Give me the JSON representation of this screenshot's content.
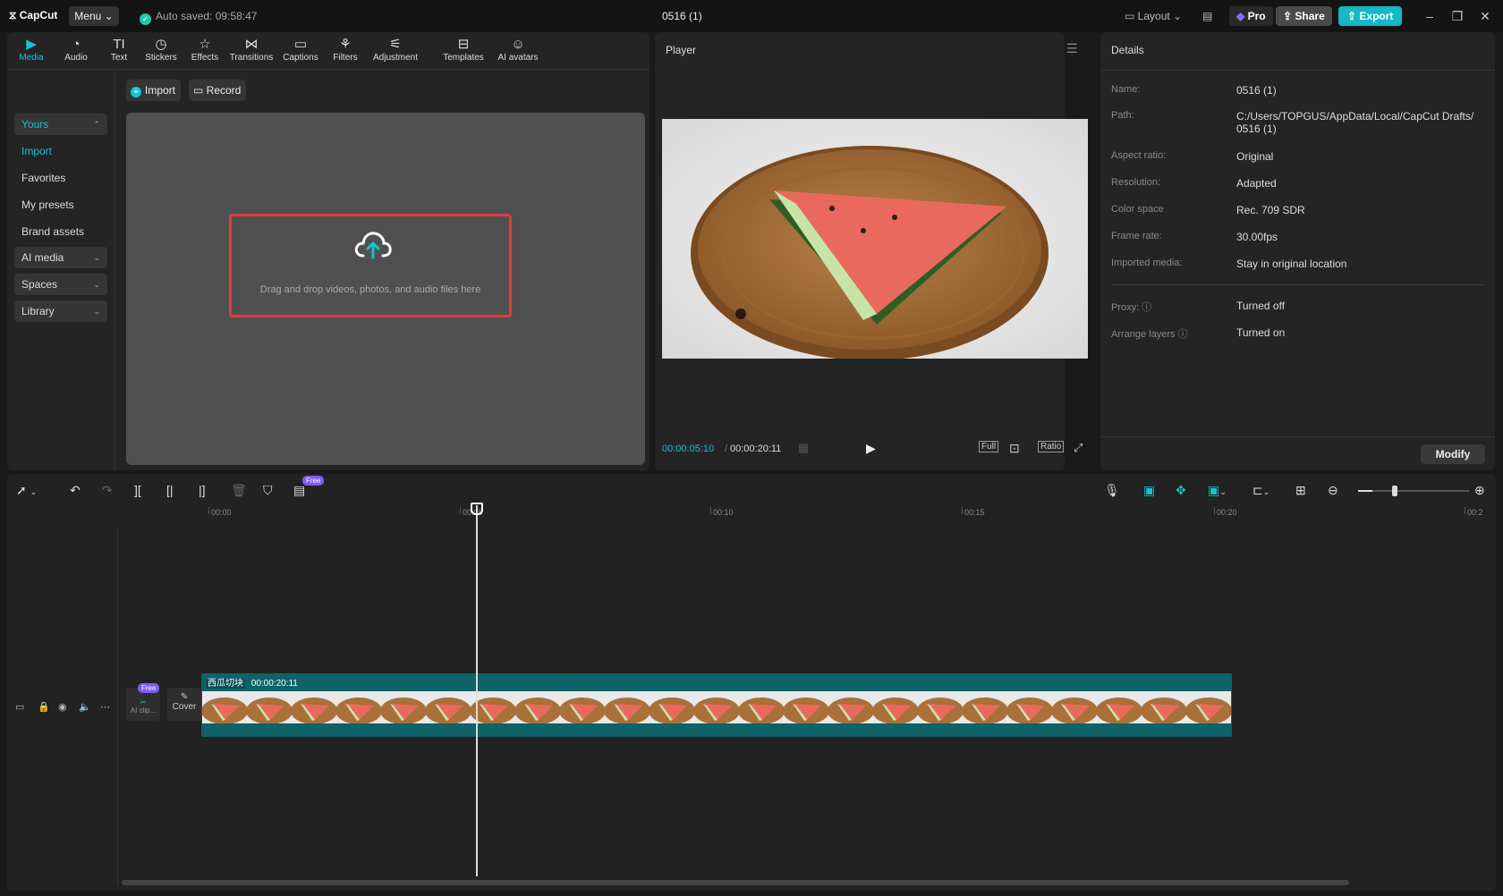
{
  "titlebar": {
    "logo": "CapCut",
    "menu": "Menu",
    "autosave": "Auto saved: 09:58:47",
    "project": "0516 (1)",
    "layout": "Layout",
    "pro": "Pro",
    "share": "Share",
    "export": "Export"
  },
  "tooltabs": [
    {
      "label": "Media",
      "icon": "media-icon"
    },
    {
      "label": "Audio",
      "icon": "audio-icon"
    },
    {
      "label": "Text",
      "icon": "text-icon"
    },
    {
      "label": "Stickers",
      "icon": "stickers-icon"
    },
    {
      "label": "Effects",
      "icon": "effects-icon"
    },
    {
      "label": "Transitions",
      "icon": "transitions-icon"
    },
    {
      "label": "Captions",
      "icon": "captions-icon"
    },
    {
      "label": "Filters",
      "icon": "filters-icon"
    },
    {
      "label": "Adjustment",
      "icon": "adjustment-icon"
    },
    {
      "label": "Templates",
      "icon": "templates-icon"
    },
    {
      "label": "AI avatars",
      "icon": "ai-avatars-icon"
    }
  ],
  "sidenav": {
    "yours": "Yours",
    "import": "Import",
    "favorites": "Favorites",
    "presets": "My presets",
    "brand": "Brand assets",
    "aimedia": "AI media",
    "spaces": "Spaces",
    "library": "Library"
  },
  "media": {
    "import_btn": "Import",
    "record_btn": "Record",
    "drop_text": "Drag and drop videos, photos, and audio files here"
  },
  "player": {
    "title": "Player",
    "current_time": "00:00:05:10",
    "total_time": "00:00:20:11",
    "full": "Full",
    "ratio": "Ratio"
  },
  "details": {
    "title": "Details",
    "rows": [
      {
        "label": "Name:",
        "value": "0516 (1)"
      },
      {
        "label": "Path:",
        "value": "C:/Users/TOPGUS/AppData/Local/CapCut Drafts/ 0516 (1)"
      },
      {
        "label": "Aspect ratio:",
        "value": "Original"
      },
      {
        "label": "Resolution:",
        "value": "Adapted"
      },
      {
        "label": "Color space",
        "value": "Rec. 709 SDR"
      },
      {
        "label": "Frame rate:",
        "value": "30.00fps"
      },
      {
        "label": "Imported media:",
        "value": "Stay in original location"
      },
      {
        "label": "Proxy:",
        "value": "Turned off"
      },
      {
        "label": "Arrange layers",
        "value": "Turned on"
      }
    ],
    "modify": "Modify"
  },
  "timeline": {
    "free_badge": "Free",
    "ticks": [
      "00:00",
      "00:05",
      "00:10",
      "00:15",
      "00:20",
      "00:2"
    ],
    "clip_name": "西瓜切块",
    "clip_duration": "00:00:20:11",
    "cover": "Cover",
    "ai_clip": "AI clip...",
    "playhead_fraction": 0.26
  },
  "colors": {
    "accent": "#18c3d1",
    "clip": "#0f6267",
    "highlight": "#e03b3b"
  }
}
